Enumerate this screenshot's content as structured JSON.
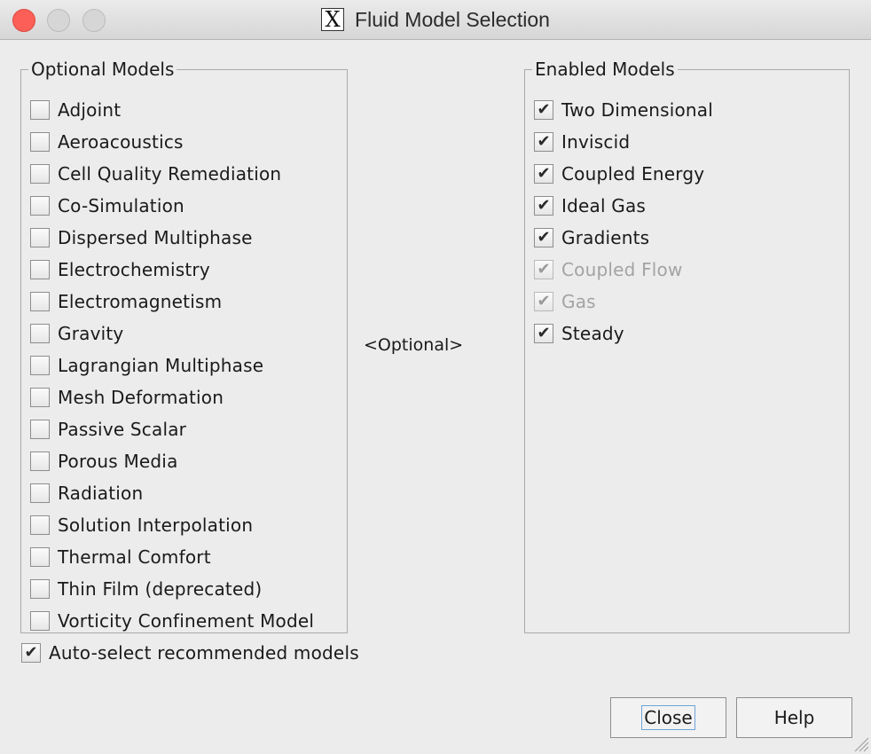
{
  "window": {
    "title": "Fluid Model Selection",
    "icon": "x-app-icon"
  },
  "optional_models": {
    "legend": "Optional Models",
    "items": [
      {
        "label": "Adjoint",
        "checked": false
      },
      {
        "label": "Aeroacoustics",
        "checked": false
      },
      {
        "label": "Cell Quality Remediation",
        "checked": false
      },
      {
        "label": "Co-Simulation",
        "checked": false
      },
      {
        "label": "Dispersed Multiphase",
        "checked": false
      },
      {
        "label": "Electrochemistry",
        "checked": false
      },
      {
        "label": "Electromagnetism",
        "checked": false
      },
      {
        "label": "Gravity",
        "checked": false
      },
      {
        "label": "Lagrangian Multiphase",
        "checked": false
      },
      {
        "label": "Mesh Deformation",
        "checked": false
      },
      {
        "label": "Passive Scalar",
        "checked": false
      },
      {
        "label": "Porous Media",
        "checked": false
      },
      {
        "label": "Radiation",
        "checked": false
      },
      {
        "label": "Solution Interpolation",
        "checked": false
      },
      {
        "label": "Thermal Comfort",
        "checked": false
      },
      {
        "label": "Thin Film (deprecated)",
        "checked": false
      },
      {
        "label": "Vorticity Confinement Model",
        "checked": false
      }
    ]
  },
  "middle": {
    "label": "<Optional>"
  },
  "enabled_models": {
    "legend": "Enabled Models",
    "items": [
      {
        "label": "Two Dimensional",
        "checked": true,
        "disabled": false
      },
      {
        "label": "Inviscid",
        "checked": true,
        "disabled": false
      },
      {
        "label": "Coupled Energy",
        "checked": true,
        "disabled": false
      },
      {
        "label": "Ideal Gas",
        "checked": true,
        "disabled": false
      },
      {
        "label": "Gradients",
        "checked": true,
        "disabled": false
      },
      {
        "label": "Coupled Flow",
        "checked": true,
        "disabled": true
      },
      {
        "label": "Gas",
        "checked": true,
        "disabled": true
      },
      {
        "label": "Steady",
        "checked": true,
        "disabled": false
      }
    ]
  },
  "auto_select": {
    "label": "Auto-select recommended models",
    "checked": true
  },
  "buttons": {
    "close": "Close",
    "help": "Help"
  },
  "colors": {
    "close_light": "#fc5f57",
    "focus_ring": "#6fa4d6",
    "disabled_text": "#a3a3a3"
  }
}
